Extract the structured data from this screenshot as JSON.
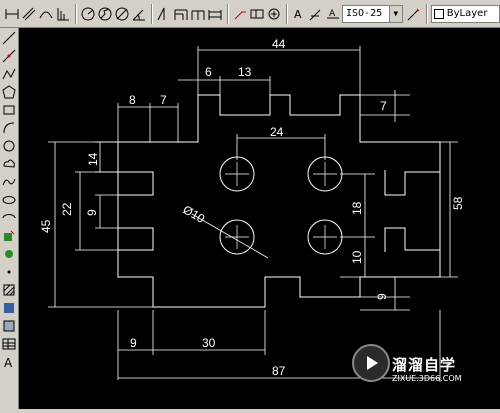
{
  "toolbar": {
    "dim_style_value": "ISO-25",
    "layer_value": "ByLayer"
  },
  "drawing": {
    "dimensions": [
      "44",
      "6",
      "13",
      "8",
      "7",
      "7",
      "24",
      "14",
      "22",
      "9",
      "45",
      "18",
      "58",
      "10",
      "9",
      "9",
      "30",
      "87"
    ],
    "diameter_label": "Ø10"
  },
  "watermark": {
    "title": "溜溜自学",
    "url": "ZIXUE.3D66.COM"
  }
}
